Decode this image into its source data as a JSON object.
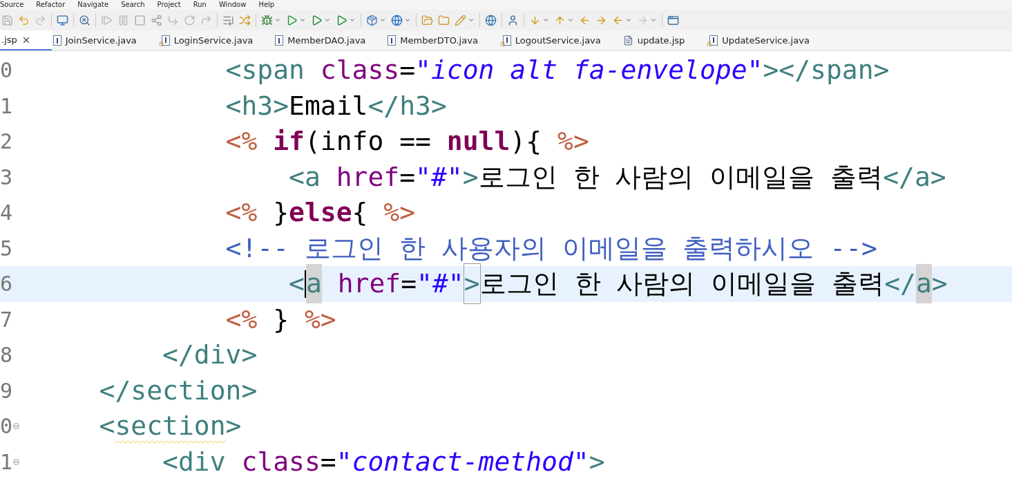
{
  "menu_bar": [
    "Source",
    "Refactor",
    "Navigate",
    "Search",
    "Project",
    "Run",
    "Window",
    "Help"
  ],
  "tabs": [
    {
      "label": ".jsp",
      "kind": "partial",
      "selected": true
    },
    {
      "label": "JoinService.java",
      "kind": "java",
      "selected": false
    },
    {
      "label": "LoginService.java",
      "kind": "java-locked",
      "selected": false
    },
    {
      "label": "MemberDAO.java",
      "kind": "java",
      "selected": false
    },
    {
      "label": "MemberDTO.java",
      "kind": "java",
      "selected": false
    },
    {
      "label": "LogoutService.java",
      "kind": "java-locked",
      "selected": false
    },
    {
      "label": "update.jsp",
      "kind": "jsp",
      "selected": false
    },
    {
      "label": "UpdateService.java",
      "kind": "java-locked",
      "selected": false
    }
  ],
  "editor": {
    "lines": [
      {
        "number": "0",
        "folding": false,
        "current": false,
        "tokens": [
          {
            "kind": "tag",
            "text": "            <span "
          },
          {
            "kind": "attr",
            "text": "class"
          },
          {
            "kind": "plain",
            "text": "="
          },
          {
            "kind": "string",
            "text": "\"icon alt fa-envelope\""
          },
          {
            "kind": "tag",
            "text": "></span>"
          }
        ]
      },
      {
        "number": "1",
        "folding": false,
        "current": false,
        "tokens": [
          {
            "kind": "tag",
            "text": "            <h3>"
          },
          {
            "kind": "plain",
            "text": "Email"
          },
          {
            "kind": "tag",
            "text": "</h3>"
          }
        ]
      },
      {
        "number": "2",
        "folding": false,
        "current": false,
        "tokens": [
          {
            "kind": "jsp",
            "text": "            <% "
          },
          {
            "kind": "keyword",
            "text": "if"
          },
          {
            "kind": "plain",
            "text": "(info == "
          },
          {
            "kind": "keyword",
            "text": "null"
          },
          {
            "kind": "plain",
            "text": "){ "
          },
          {
            "kind": "jsp",
            "text": "%>"
          }
        ]
      },
      {
        "number": "3",
        "folding": false,
        "current": false,
        "tokens": [
          {
            "kind": "tag",
            "text": "                <a "
          },
          {
            "kind": "attr",
            "text": "href"
          },
          {
            "kind": "plain",
            "text": "="
          },
          {
            "kind": "string",
            "text": "\"#\""
          },
          {
            "kind": "tag",
            "text": ">"
          },
          {
            "kind": "plain",
            "text": "로그인 한 사람의 이메일을 출력"
          },
          {
            "kind": "tag",
            "text": "</a>"
          }
        ]
      },
      {
        "number": "4",
        "folding": false,
        "current": false,
        "tokens": [
          {
            "kind": "jsp",
            "text": "            <% "
          },
          {
            "kind": "plain",
            "text": "}"
          },
          {
            "kind": "keyword",
            "text": "else"
          },
          {
            "kind": "plain",
            "text": "{ "
          },
          {
            "kind": "jsp",
            "text": "%>"
          }
        ]
      },
      {
        "number": "5",
        "folding": false,
        "current": false,
        "tokens": [
          {
            "kind": "comment",
            "text": "            <!-- 로그인 한 사용자의 이메일을 출력하시오 -->"
          }
        ]
      },
      {
        "number": "6",
        "folding": false,
        "current": true,
        "tokens": [
          {
            "kind": "tag",
            "text": "                <"
          },
          {
            "kind": "tag",
            "text": "a",
            "match": true,
            "caret": true
          },
          {
            "kind": "attr",
            "text": " href"
          },
          {
            "kind": "plain",
            "text": "="
          },
          {
            "kind": "string",
            "text": "\"#\""
          },
          {
            "kind": "tag",
            "text": ">",
            "boxed": true
          },
          {
            "kind": "plain",
            "text": "로그인 한 사람의 이메일을 출력"
          },
          {
            "kind": "tag",
            "text": "</"
          },
          {
            "kind": "tag",
            "text": "a",
            "match": true
          },
          {
            "kind": "tag",
            "text": ">"
          }
        ]
      },
      {
        "number": "7",
        "folding": false,
        "current": false,
        "tokens": [
          {
            "kind": "jsp",
            "text": "            <% "
          },
          {
            "kind": "plain",
            "text": "} "
          },
          {
            "kind": "jsp",
            "text": "%>"
          }
        ]
      },
      {
        "number": "8",
        "folding": false,
        "current": false,
        "tokens": [
          {
            "kind": "tag",
            "text": "        </div>"
          }
        ]
      },
      {
        "number": "9",
        "folding": false,
        "current": false,
        "tokens": [
          {
            "kind": "tag",
            "text": "    </section>"
          }
        ]
      },
      {
        "number": "0",
        "folding": true,
        "current": false,
        "tokens": [
          {
            "kind": "tag",
            "text": "    <"
          },
          {
            "kind": "tag",
            "text": "section",
            "warning": true
          },
          {
            "kind": "tag",
            "text": ">"
          }
        ]
      },
      {
        "number": "1",
        "folding": true,
        "current": false,
        "tokens": [
          {
            "kind": "tag",
            "text": "        <div "
          },
          {
            "kind": "attr",
            "text": "class"
          },
          {
            "kind": "plain",
            "text": "="
          },
          {
            "kind": "string",
            "text": "\"contact-method\""
          },
          {
            "kind": "tag",
            "text": ">"
          }
        ]
      }
    ]
  }
}
